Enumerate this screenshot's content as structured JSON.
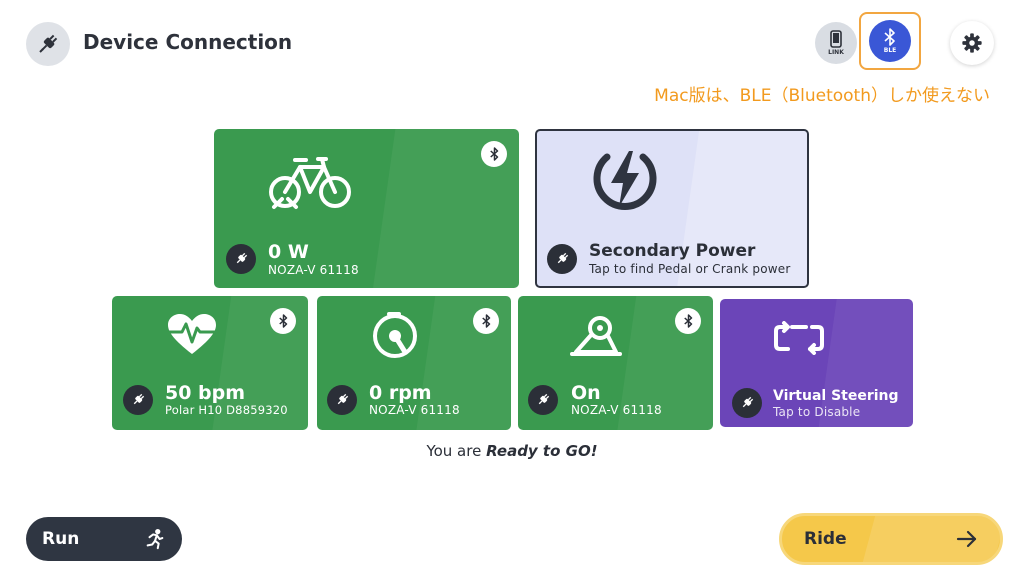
{
  "header": {
    "title": "Device Connection",
    "link_label": "LINK",
    "ble_label": "BLE"
  },
  "annotation": "Mac版は、BLE（Bluetooth）しか使えない",
  "tiles": {
    "power": {
      "value": "0 W",
      "device": "NOZA-V 61118"
    },
    "secondary_power": {
      "title": "Secondary Power",
      "subtitle": "Tap to find Pedal or Crank power"
    },
    "heart_rate": {
      "value": "50 bpm",
      "device": "Polar H10 D8859320"
    },
    "cadence": {
      "value": "0 rpm",
      "device": "NOZA-V 61118"
    },
    "trainer": {
      "value": "On",
      "device": "NOZA-V 61118"
    },
    "steering": {
      "title": "Virtual Steering",
      "subtitle": "Tap to Disable"
    }
  },
  "status": {
    "prefix": "You are ",
    "emphasis": "Ready to GO!"
  },
  "buttons": {
    "run": "Run",
    "ride": "Ride"
  },
  "colors": {
    "connected_tile": "#3a9a4f",
    "secondary_tile": "#dee1f7",
    "steering_tile": "#6b45b8",
    "ble_active": "#3a57d6",
    "annotation": "#f29a1e",
    "ride_button": "#f5c84a",
    "run_button": "#2f3642"
  },
  "icons": {
    "header": "plug-icon",
    "link": "phone-icon",
    "ble": "bluetooth-icon",
    "settings": "gear-icon",
    "power": "bike-icon",
    "secondary": "bolt-icon",
    "heart_rate": "heart-pulse-icon",
    "cadence": "crank-icon",
    "trainer": "trainer-icon",
    "steering": "steering-icon",
    "run": "runner-icon",
    "ride": "arrow-right-icon"
  }
}
